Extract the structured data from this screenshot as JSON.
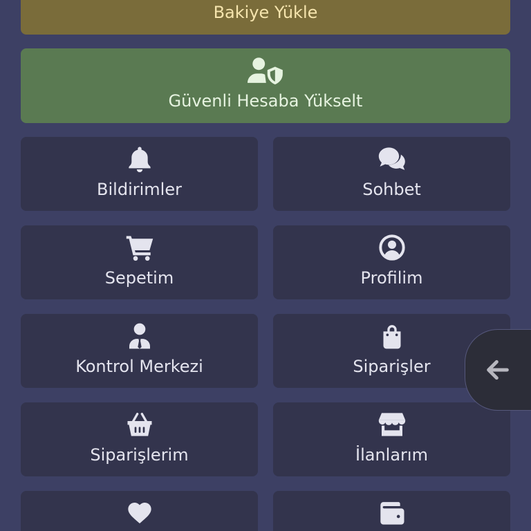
{
  "colors": {
    "background": "#3d4064",
    "tile": "#33344d",
    "load_balance": "#7a6c3a",
    "upgrade": "#5a7a52",
    "floating_button": "#2c2d38"
  },
  "top_actions": {
    "load_balance": {
      "label": "Bakiye Yükle"
    },
    "upgrade": {
      "label": "Güvenli Hesaba Yükselt",
      "icon": "user-shield-icon"
    }
  },
  "menu": {
    "tiles": [
      {
        "label": "Bildirimler",
        "icon": "bell-icon"
      },
      {
        "label": "Sohbet",
        "icon": "comments-icon"
      },
      {
        "label": "Sepetim",
        "icon": "cart-icon"
      },
      {
        "label": "Profilim",
        "icon": "user-circle-icon"
      },
      {
        "label": "Kontrol Merkezi",
        "icon": "user-tie-icon"
      },
      {
        "label": "Siparişler",
        "icon": "shopping-bag-icon"
      },
      {
        "label": "Siparişlerim",
        "icon": "basket-icon"
      },
      {
        "label": "İlanlarım",
        "icon": "store-icon"
      },
      {
        "icon": "heart-icon"
      },
      {
        "icon": "wallet-icon"
      }
    ]
  },
  "floating_button": {
    "icon": "arrow-left-icon"
  }
}
